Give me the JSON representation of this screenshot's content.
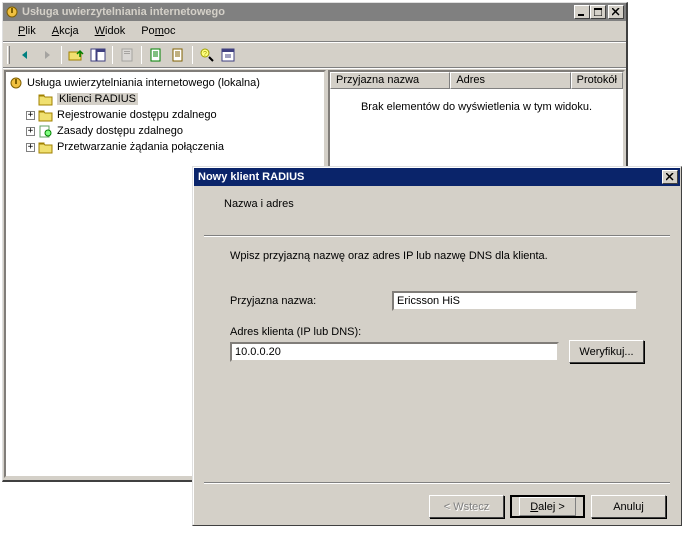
{
  "main_window": {
    "title": "Usługa uwierzytelniania internetowego",
    "menu": [
      "Plik",
      "Akcja",
      "Widok",
      "Pomoc"
    ],
    "tree": {
      "root": "Usługa uwierzytelniania internetowego (lokalna)",
      "items": [
        {
          "label": "Klienci RADIUS",
          "selected": true,
          "expandable": false
        },
        {
          "label": "Rejestrowanie dostępu zdalnego",
          "selected": false,
          "expandable": true
        },
        {
          "label": "Zasady dostępu zdalnego",
          "selected": false,
          "expandable": true
        },
        {
          "label": "Przetwarzanie żądania połączenia",
          "selected": false,
          "expandable": true
        }
      ]
    },
    "list": {
      "columns": [
        "Przyjazna nazwa",
        "Adres",
        "Protokół"
      ],
      "empty_message": "Brak elementów do wyświetlenia w tym widoku."
    }
  },
  "dialog": {
    "title": "Nowy klient RADIUS",
    "section_title": "Nazwa i adres",
    "instruction": "Wpisz przyjazną nazwę oraz adres IP lub nazwę DNS dla klienta.",
    "friendly_name_label": "Przyjazna nazwa:",
    "friendly_name_value": "Ericsson HiS",
    "address_label": "Adres klienta (IP lub DNS):",
    "address_value": "10.0.0.20",
    "verify_button": "Weryfikuj...",
    "back_button": "< Wstecz",
    "next_button": "Dalej >",
    "cancel_button": "Anuluj"
  }
}
